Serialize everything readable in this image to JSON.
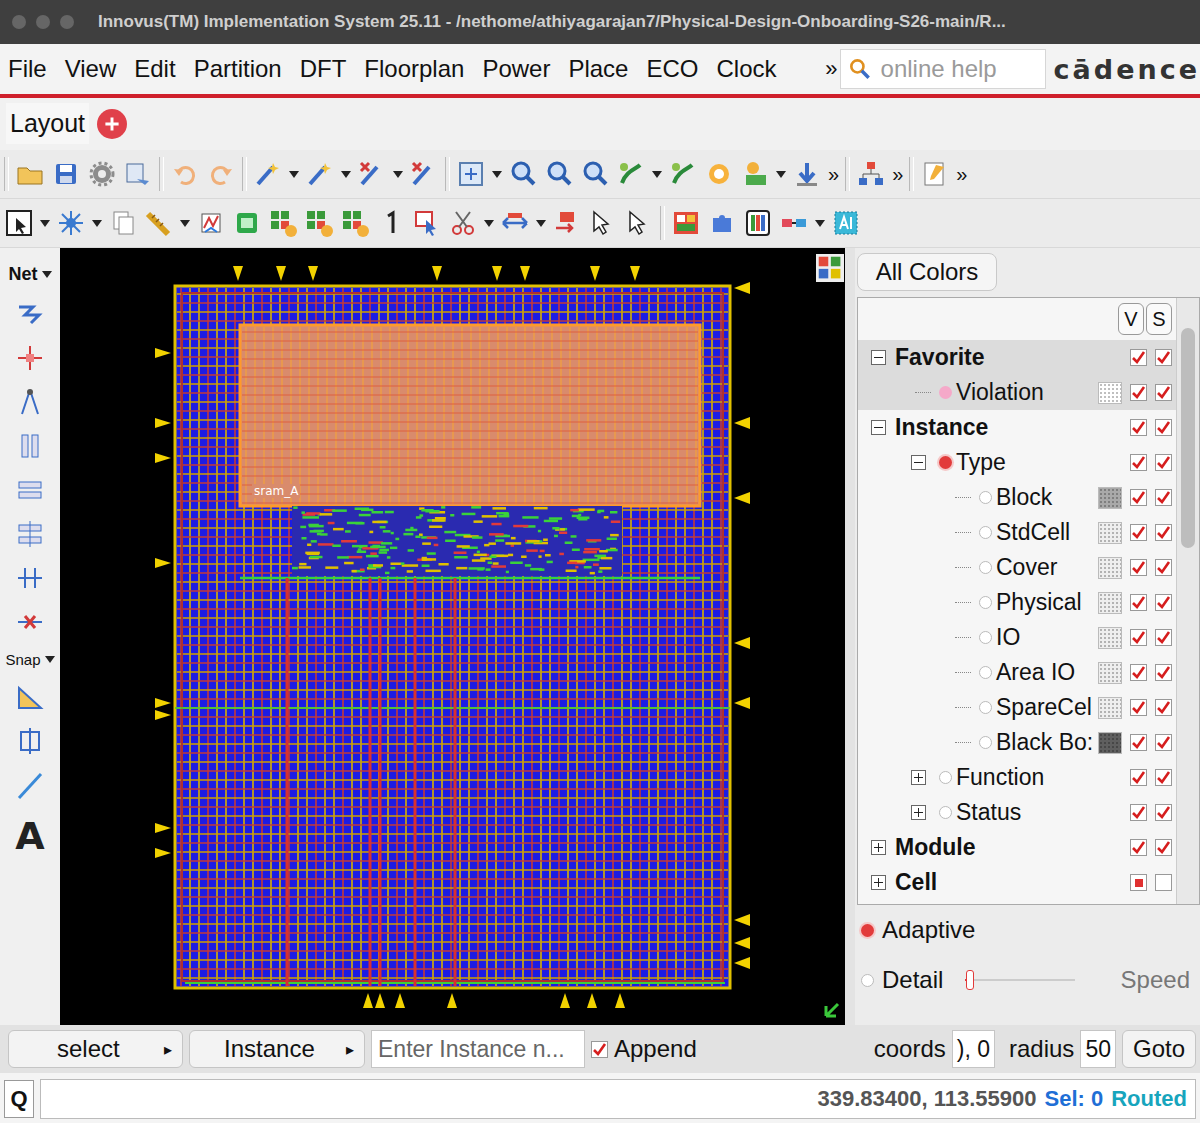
{
  "window": {
    "title": "Innovus(TM) Implementation System 25.11 - /nethome/athiyagarajan7/Physical-Design-Onboarding-S26-main/R..."
  },
  "menu": [
    "File",
    "View",
    "Edit",
    "Partition",
    "DFT",
    "Floorplan",
    "Power",
    "Place",
    "ECO",
    "Clock"
  ],
  "menu_more": "»",
  "search": {
    "placeholder": "online help"
  },
  "logo": "cādence",
  "tabs": [
    {
      "label": "Layout",
      "selected": true
    }
  ],
  "toolbar_more": [
    "»",
    "»",
    "»"
  ],
  "left_toolbar": {
    "net_label": "Net",
    "snap_label": "Snap",
    "text_tool": "A"
  },
  "canvas": {
    "block_label": "sram_A"
  },
  "color_panel": {
    "preset": "All Colors",
    "columns": [
      "V",
      "S"
    ],
    "tree": [
      {
        "label": "Favorite",
        "depth": 0,
        "kind": "group",
        "expanded": true,
        "highlighted": true,
        "v": "checked",
        "s": "checked"
      },
      {
        "label": "Violation",
        "depth": 1,
        "kind": "legend",
        "dot_color": "#f5a9c9",
        "swatch": "#ffffff",
        "highlighted": true,
        "v": "checked",
        "s": "checked"
      },
      {
        "label": "Instance",
        "depth": 0,
        "kind": "group",
        "expanded": true,
        "highlighted": false,
        "v": "checked",
        "s": "checked"
      },
      {
        "label": "Type",
        "depth": 1,
        "kind": "radio",
        "expanded": true,
        "radio_on": true,
        "highlighted": false,
        "v": "checked",
        "s": "checked"
      },
      {
        "label": "Block",
        "depth": 2,
        "kind": "radio",
        "radio_on": false,
        "swatch": "#a9a9a9",
        "highlighted": false,
        "v": "checked",
        "s": "checked"
      },
      {
        "label": "StdCell",
        "depth": 2,
        "kind": "radio",
        "radio_on": false,
        "swatch": "#eeeeee",
        "highlighted": false,
        "v": "checked",
        "s": "checked"
      },
      {
        "label": "Cover",
        "depth": 2,
        "kind": "radio",
        "radio_on": false,
        "swatch": "#eeeeee",
        "highlighted": false,
        "v": "checked",
        "s": "checked"
      },
      {
        "label": "Physical",
        "depth": 2,
        "kind": "radio",
        "radio_on": false,
        "swatch": "#eeeeee",
        "highlighted": false,
        "v": "checked",
        "s": "checked"
      },
      {
        "label": "IO",
        "depth": 2,
        "kind": "radio",
        "radio_on": false,
        "swatch": "#eeeeee",
        "highlighted": false,
        "v": "checked",
        "s": "checked"
      },
      {
        "label": "Area IO",
        "depth": 2,
        "kind": "radio",
        "radio_on": false,
        "swatch": "#eeeeee",
        "highlighted": false,
        "v": "checked",
        "s": "checked"
      },
      {
        "label": "SpareCel",
        "depth": 2,
        "kind": "radio",
        "radio_on": false,
        "swatch": "#eeeeee",
        "highlighted": false,
        "v": "checked",
        "s": "checked"
      },
      {
        "label": "Black Bo:",
        "depth": 2,
        "kind": "radio",
        "radio_on": false,
        "swatch": "#5f5f5f",
        "highlighted": false,
        "v": "checked",
        "s": "checked"
      },
      {
        "label": "Function",
        "depth": 1,
        "kind": "radio",
        "expanded": false,
        "radio_on": false,
        "highlighted": false,
        "v": "checked",
        "s": "checked"
      },
      {
        "label": "Status",
        "depth": 1,
        "kind": "radio",
        "expanded": false,
        "radio_on": false,
        "highlighted": false,
        "v": "checked",
        "s": "checked"
      },
      {
        "label": "Module",
        "depth": 0,
        "kind": "group",
        "expanded": false,
        "highlighted": false,
        "v": "checked",
        "s": "checked"
      },
      {
        "label": "Cell",
        "depth": 0,
        "kind": "group",
        "expanded": false,
        "highlighted": false,
        "v": "partial",
        "s": "unchecked"
      }
    ],
    "modes": [
      {
        "label": "Adaptive",
        "selected": true
      },
      {
        "label": "Detail",
        "selected": false
      }
    ],
    "slider": {
      "label": "Speed",
      "level": 0.02
    }
  },
  "bottom_bar": {
    "mode": "select",
    "mode_arrow": "▸",
    "object_type": "Instance",
    "object_arrow": "▸",
    "placeholder": "Enter Instance n...",
    "append": {
      "label": "Append",
      "checked": true
    },
    "coords_label": "coords",
    "coords_value": "), 0",
    "radius_label": "radius",
    "radius_value": "50",
    "goto": "Goto"
  },
  "command": {
    "prompt": "Q",
    "coords": "339.83400, 113.55900",
    "sel": "Sel: 0",
    "status": "Routed"
  }
}
